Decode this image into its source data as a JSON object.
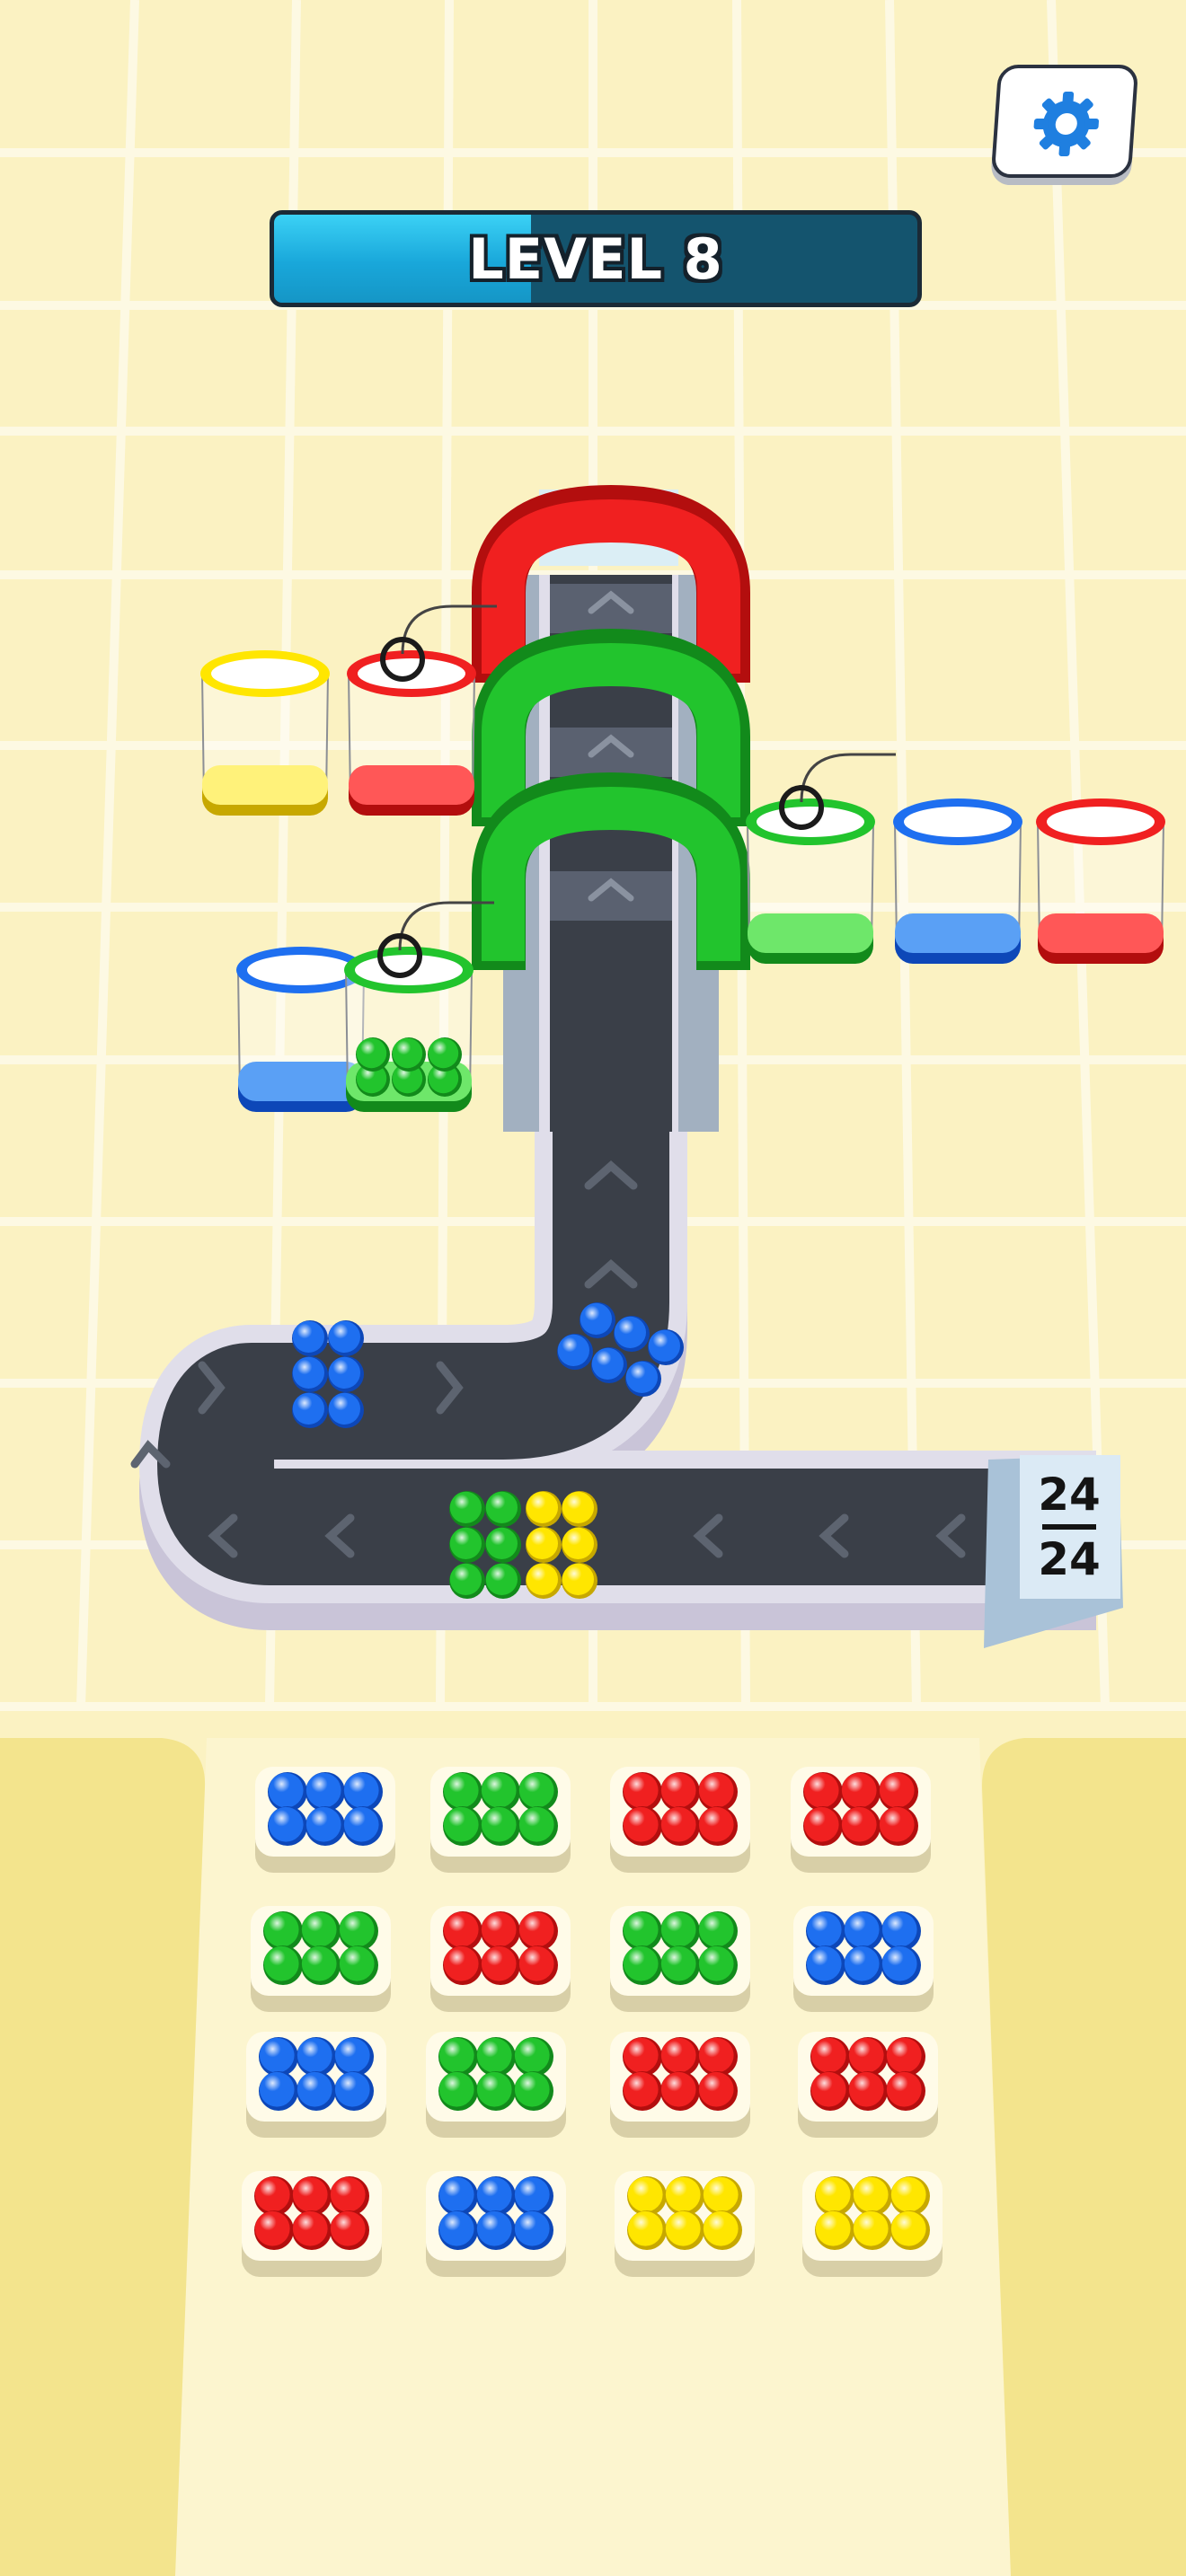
{
  "hud": {
    "level_label": "LEVEL 8",
    "level_progress": 0.4,
    "settings_icon": "gear-icon"
  },
  "counter": {
    "numerator": "24",
    "denominator": "24"
  },
  "colors": {
    "blue": "#1e6ff0",
    "green": "#1fb82a",
    "red": "#ee1c1c",
    "yellow": "#ffe600",
    "belt": "#3a3f48",
    "belt_rim": "#d9d7e4",
    "level_fill": "#1fa9dd",
    "level_track": "#14546e"
  },
  "sorting_cups": [
    {
      "color": "yellow",
      "has_link": false,
      "balls": 0
    },
    {
      "color": "red",
      "has_link": true,
      "balls": 0
    },
    {
      "color": "green",
      "has_link": true,
      "balls": 0
    },
    {
      "color": "blue",
      "has_link": false,
      "balls": 0
    },
    {
      "color": "red",
      "has_link": false,
      "balls": 0
    },
    {
      "color": "blue",
      "has_link": false,
      "balls": 0
    },
    {
      "color": "green",
      "has_link": true,
      "balls": 6
    }
  ],
  "gates": [
    "red",
    "green",
    "green"
  ],
  "belt_balls": [
    "blue",
    "blue",
    "green",
    "yellow"
  ],
  "trays": [
    [
      "blue",
      "green",
      "red",
      "red"
    ],
    [
      "green",
      "red",
      "green",
      "blue"
    ],
    [
      "blue",
      "green",
      "red",
      "red"
    ],
    [
      "red",
      "blue",
      "yellow",
      "yellow"
    ]
  ]
}
